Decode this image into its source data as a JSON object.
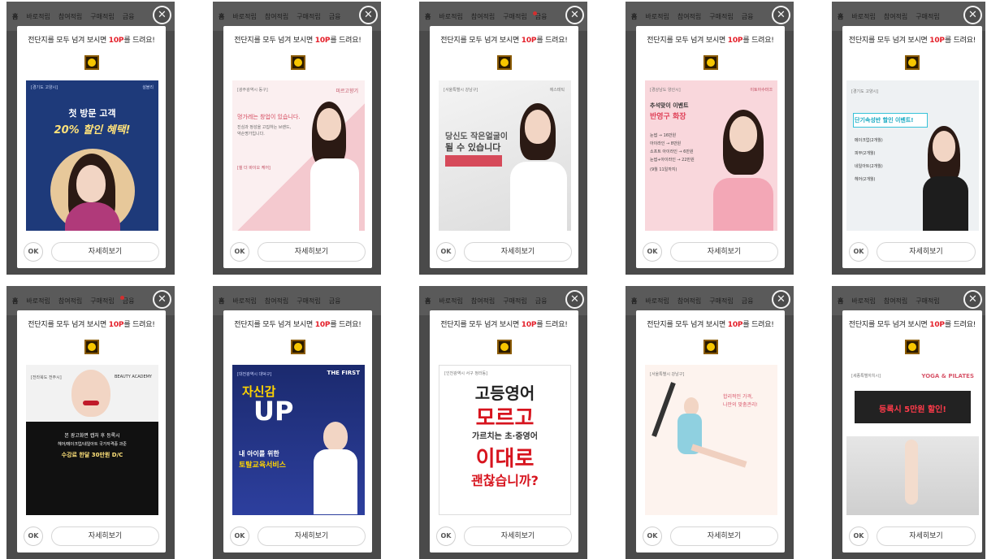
{
  "nav": {
    "home": "홈",
    "tabs": [
      "바로적립",
      "참여적립",
      "구매적립",
      "금융"
    ]
  },
  "popup": {
    "headline_pre": "전단지를 모두 넘겨 보시면 ",
    "headline_pts": "10P",
    "headline_post": "를 드려요!",
    "ok_label": "OK",
    "detail_label": "자세히보기",
    "close_glyph": "✕"
  },
  "ads": [
    {
      "tag": "[경기도 고양시]",
      "top": "설블리",
      "l1": "첫 방문 고객",
      "l2": "20% 할인 혜택!"
    },
    {
      "tag": "[광주광역시 동구]",
      "brand": "미르고향기",
      "l1": "멍가레는 창업이 있습니다.",
      "l2": "진심과 정성을 고집하는 브랜드,",
      "l3": "약손명가입니다.",
      "l4": "[쉴 더 바이오 케어]"
    },
    {
      "tag": "[서울특별시 강남구]",
      "brand": "에스테틱",
      "l1": "당신도 작은얼굴이",
      "l2": "될 수 있습니다"
    },
    {
      "tag": "[경상남도 양산시]",
      "brand": "이토아수마끄",
      "l1": "추석맞이 이벤트",
      "l2": "반영구 화장",
      "items": [
        "눈썹 → 16만원",
        "아이라인 → 8만원",
        "소프트 아이라인 → 6만원",
        "눈썹+아이라인 → 22만원"
      ],
      "date": "(9월 11일까지)"
    },
    {
      "tag": "[경기도 고양시]",
      "l1": "단기속성반 할인 이벤트!",
      "items": [
        "메이크업(2개월)",
        "피부(2개월)",
        "네일아트(2개월)",
        "헤어(2개월)"
      ]
    },
    {
      "tag": "[전라북도 전주시]",
      "brand": "BEAUTY ACADEMY",
      "l1": "본 광고화면 캡처 후 등록시",
      "l2": "헤어/메이크업/네일아트 국가자격증 과준",
      "l3": "수강료 한달 30만원 D/C"
    },
    {
      "tag": "[대전광역시 대덕구]",
      "brand": "THE FIRST",
      "l1": "자신감",
      "l2": "UP",
      "l3": "내 아이를 위한",
      "l4": "토탈교육서비스"
    },
    {
      "tag": "[인천광역시 서구 청라동]",
      "l1": "고등영어",
      "l2": "모르고",
      "l3": "가르치는 초·중영어",
      "l4": "이대로",
      "l5": "괜찮습니까?"
    },
    {
      "tag": "[서울특별시 강남구]",
      "l1": "합리적인 가격,",
      "l2": "나만의 맞춤관리!"
    },
    {
      "tag": "[세종특별자치시]",
      "brand": "YOGA & PILATES",
      "l1": "등록시 5만원 할인!"
    }
  ],
  "colors": {
    "accent_red": "#e4202a",
    "frame_gray": "#4a4a4a",
    "coin_gold": "#f7c600"
  }
}
